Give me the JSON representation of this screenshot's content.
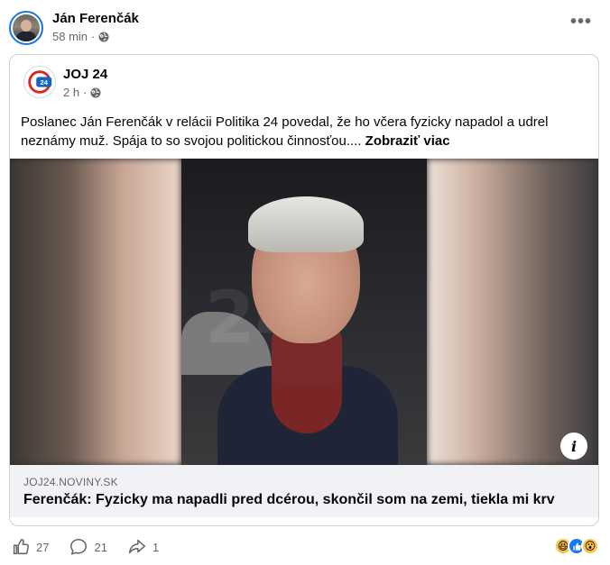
{
  "post": {
    "author": "Ján Ferenčák",
    "time": "58 min",
    "privacy_icon": "globe-icon",
    "more_label": "•••"
  },
  "shared": {
    "author": "JOJ 24",
    "time": "2 h",
    "privacy_icon": "globe-icon",
    "text": "Poslanec Ján Ferenčák v relácii Politika 24 povedal, že ho včera fyzicky napadol a udrel neznámy muž. Spája to so svojou politickou činnosťou....",
    "see_more": "Zobraziť viac",
    "link": {
      "domain": "JOJ24.NOVINY.SK",
      "title": "Ferenčák: Fyzicky ma napadli pred dcérou, skončil som na zemi, tiekla mi krv"
    },
    "info_label": "i"
  },
  "footer": {
    "like_count": "27",
    "comment_count": "21",
    "share_count": "1",
    "reactions": [
      "haha",
      "like",
      "wow"
    ]
  },
  "colors": {
    "accent": "#1877f2",
    "muted": "#65676b",
    "logo_red": "#e2231a"
  }
}
